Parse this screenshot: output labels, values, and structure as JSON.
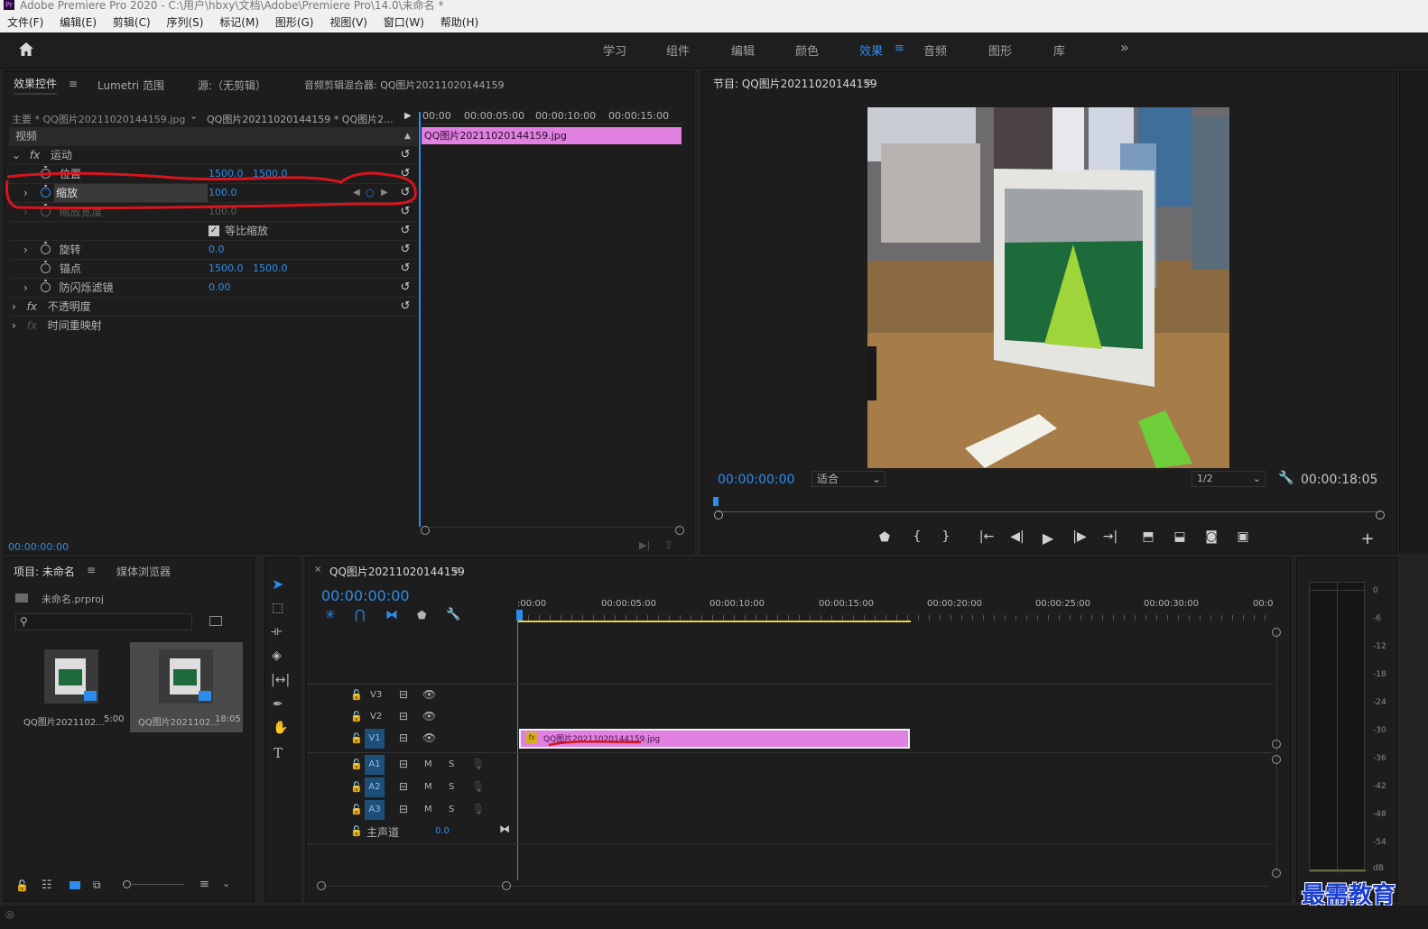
{
  "app": {
    "title": "Adobe Premiere Pro 2020 - C:\\用户\\hbxy\\文档\\Adobe\\Premiere Pro\\14.0\\未命名 *",
    "logo": "Pr"
  },
  "menu": [
    "文件(F)",
    "编辑(E)",
    "剪辑(C)",
    "序列(S)",
    "标记(M)",
    "图形(G)",
    "视图(V)",
    "窗口(W)",
    "帮助(H)"
  ],
  "workspaces": [
    "学习",
    "组件",
    "编辑",
    "颜色",
    "效果",
    "音频",
    "图形",
    "库"
  ],
  "active_workspace": "效果",
  "more_glyph": "»",
  "effect_controls": {
    "tabs": [
      "效果控件",
      "Lumetri 范围",
      "源:（无剪辑）",
      "音频剪辑混合器: QQ图片20211020144159"
    ],
    "source_clip": "主要 * QQ图片20211020144159.jpg",
    "sequence_clip": "QQ图片20211020144159 * QQ图片2...",
    "section": "视频",
    "ruler": [
      "00:00",
      "00:00:05:00",
      "00:00:10:00",
      "00:00:15:00"
    ],
    "clip_bar": "QQ图片20211020144159.jpg",
    "motion": "运动",
    "properties": [
      {
        "name": "位置",
        "v1": "1500.0",
        "v2": "1500.0"
      },
      {
        "name": "缩放",
        "v1": "100.0",
        "v2": ""
      },
      {
        "name": "缩放宽度",
        "v1": "100.0",
        "v2": ""
      },
      {
        "name": "等比缩放",
        "v1": "",
        "v2": ""
      },
      {
        "name": "旋转",
        "v1": "0.0",
        "v2": ""
      },
      {
        "name": "锚点",
        "v1": "1500.0",
        "v2": "1500.0"
      },
      {
        "name": "防闪烁滤镜",
        "v1": "0.00",
        "v2": ""
      }
    ],
    "opacity": "不透明度",
    "time_remap": "时间重映射",
    "timecode": "00:00:00:00"
  },
  "program": {
    "title": "节目: QQ图片20211020144159",
    "timecode": "00:00:00:00",
    "fit": "适合",
    "resolution": "1/2",
    "duration": "00:00:18:05"
  },
  "project": {
    "tabs": [
      "项目: 未命名",
      "媒体浏览器"
    ],
    "file": "未命名.prproj",
    "search_placeholder": "",
    "items": [
      {
        "name": "QQ图片2021102...",
        "duration": "5:00"
      },
      {
        "name": "QQ图片2021102...",
        "duration": "18:05"
      }
    ]
  },
  "timeline": {
    "title": "QQ图片20211020144159",
    "timecode": "00:00:00:00",
    "ruler": [
      ":00:00",
      "00:00:05:00",
      "00:00:10:00",
      "00:00:15:00",
      "00:00:20:00",
      "00:00:25:00",
      "00:00:30:00",
      "00:0"
    ],
    "tracks": [
      "V3",
      "V2",
      "V1",
      "A1",
      "A2",
      "A3"
    ],
    "master": "主声道",
    "master_value": "0.0",
    "clip": "QQ图片20211020144159.jpg",
    "ms_labels": [
      "M",
      "S"
    ]
  },
  "meter": {
    "ticks": [
      "0",
      "-6",
      "-12",
      "-18",
      "-24",
      "-30",
      "-36",
      "-42",
      "-48",
      "-54",
      "dB"
    ]
  },
  "watermark": "最需教育",
  "colors": {
    "accent": "#2d8ceb",
    "clip": "#e080e0",
    "annotation": "#d8141c"
  }
}
